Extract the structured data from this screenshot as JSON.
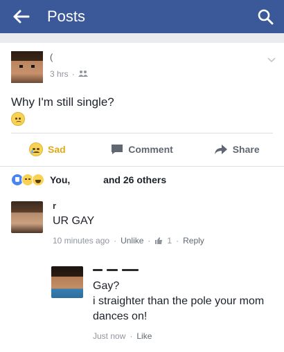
{
  "header": {
    "title": "Posts",
    "bg_color": "#3b5998"
  },
  "post": {
    "author_name": "(",
    "time": "3 hrs",
    "separator": "·",
    "audience_icon": "friends-icon",
    "text": "Why I'm still single?",
    "emoji_icon": "slightly-frowning-face-emoji",
    "actions": {
      "reaction_label": "Sad",
      "comment_label": "Comment",
      "share_label": "Share"
    }
  },
  "reactions": {
    "icons": [
      "like-icon",
      "sad-icon",
      "haha-icon"
    ],
    "summary_start": "You,",
    "summary_end": "and 26 others"
  },
  "comments": [
    {
      "name_fragment": "r",
      "text": "UR GAY",
      "time": "10 minutes ago",
      "action_unlike": "Unlike",
      "like_count": "1",
      "action_reply": "Reply"
    }
  ],
  "reply": {
    "text_line1": "Gay?",
    "text_line2": "i straighter than the pole your mom",
    "text_line3": "dances on!",
    "time": "Just now",
    "action_like": "Like"
  },
  "colors": {
    "sad_accent": "#e0a917",
    "meta_gray": "#90949c",
    "action_gray": "#606770",
    "like_blue": "#4a84f3"
  }
}
